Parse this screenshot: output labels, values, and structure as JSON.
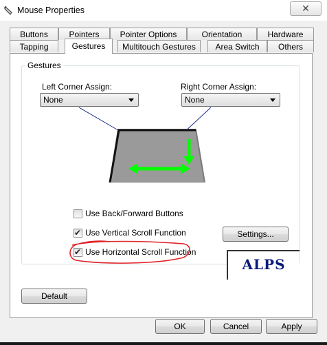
{
  "window": {
    "title": "Mouse Properties",
    "close_label": "✕"
  },
  "tabs": {
    "row1": [
      {
        "label": "Buttons"
      },
      {
        "label": "Pointers"
      },
      {
        "label": "Pointer Options"
      },
      {
        "label": "Orientation"
      },
      {
        "label": "Hardware"
      }
    ],
    "row2": [
      {
        "label": "Tapping"
      },
      {
        "label": "Gestures",
        "active": true
      },
      {
        "label": "Multitouch Gestures"
      },
      {
        "label": "Area Switch"
      },
      {
        "label": "Others"
      }
    ]
  },
  "gestures": {
    "group_title": "Gestures",
    "left_corner_label": "Left Corner Assign:",
    "left_corner_value": "None",
    "right_corner_label": "Right Corner Assign:",
    "right_corner_value": "None",
    "options": [
      {
        "label": "Use Back/Forward Buttons",
        "checked": false
      },
      {
        "label": "Use Vertical Scroll Function",
        "checked": true
      },
      {
        "label": "Use Horizontal Scroll Function",
        "checked": true
      }
    ],
    "settings_label": "Settings...",
    "highlight_color": "#e0232a",
    "arrow_color": "#00ff00"
  },
  "logo_text": "ALPS",
  "buttons": {
    "default_label": "Default",
    "ok_label": "OK",
    "cancel_label": "Cancel",
    "apply_label": "Apply"
  },
  "icons": {
    "title_icon": "mouse-icon",
    "close_icon": "close-icon",
    "dropdown_icon": "chevron-down-icon",
    "check_icon": "check-icon"
  }
}
